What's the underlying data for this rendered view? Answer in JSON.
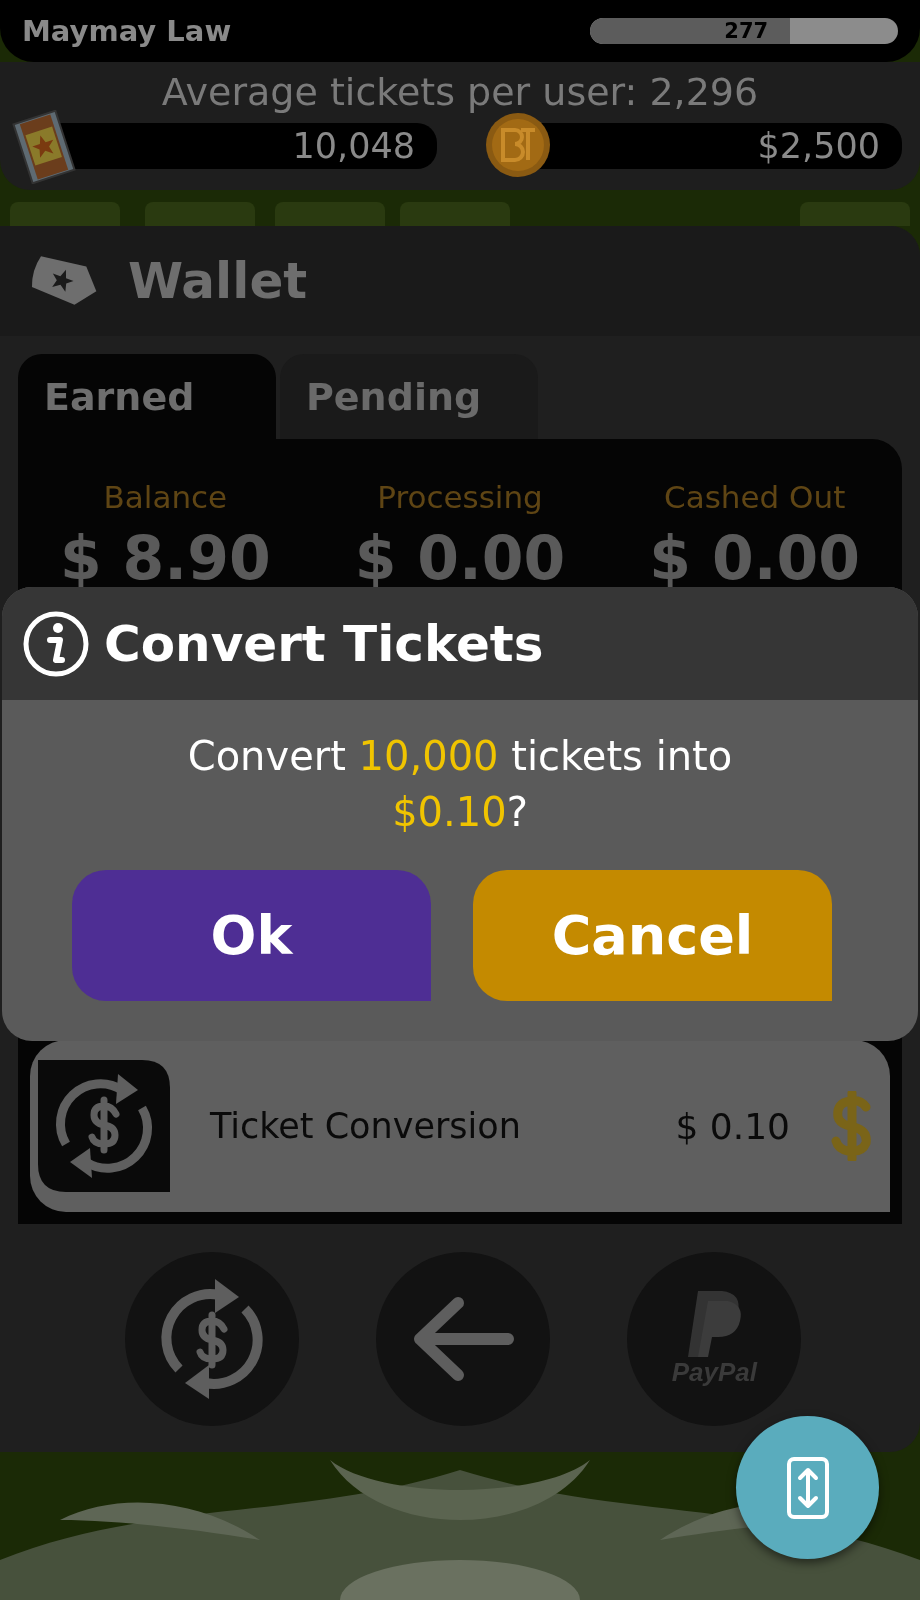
{
  "header": {
    "user_name": "Maymay Law",
    "progress": {
      "label": "277",
      "level": 0.65
    }
  },
  "average_tickets": "Average tickets per user: 2,296",
  "counters": [
    {
      "kind": "tickets",
      "value": "10,048"
    },
    {
      "kind": "coins",
      "value": "$2,500"
    }
  ],
  "wallet": {
    "title": "Wallet",
    "tabs": [
      {
        "label": "Earned",
        "selected": true
      },
      {
        "label": "Pending",
        "selected": false
      }
    ],
    "summary": [
      {
        "label": "Balance",
        "value": "$ 8.90"
      },
      {
        "label": "Processing",
        "value": "$ 0.00"
      },
      {
        "label": "Cashed Out",
        "value": "$ 0.00"
      }
    ],
    "transactions": [
      {
        "title": "Ticket Conversion",
        "amount": "$ 0.10"
      }
    ],
    "actions": [
      {
        "kind": "convert"
      },
      {
        "kind": "back"
      },
      {
        "kind": "paypal",
        "label": "PayPal"
      }
    ]
  },
  "dialog": {
    "title": "Convert Tickets",
    "message": "Convert **10,000** tickets into **$0.10**?",
    "buttons": [
      {
        "kind": "confirm",
        "label": "Ok"
      },
      {
        "kind": "cancel",
        "label": "Cancel"
      }
    ]
  }
}
